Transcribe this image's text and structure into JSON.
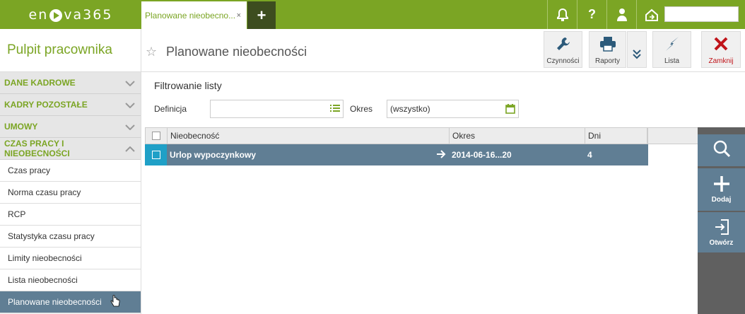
{
  "app": {
    "logo": "enova365"
  },
  "tabs": [
    {
      "label": "Planowane nieobecno...",
      "close": "×"
    }
  ],
  "add_tab_label": "+",
  "top_icons": [
    {
      "name": "bell-icon",
      "glyph": "🔔"
    },
    {
      "name": "help-icon",
      "glyph": "?"
    },
    {
      "name": "user-icon",
      "glyph": "👤"
    },
    {
      "name": "home-icon",
      "glyph": "⌂"
    }
  ],
  "sidebar": {
    "title": "Pulpit pracownika",
    "groups": [
      {
        "label": "DANE KADROWE",
        "chevron": "⌄"
      },
      {
        "label": "KADRY POZOSTAŁE",
        "chevron": "⌄"
      },
      {
        "label": "UMOWY",
        "chevron": "⌄"
      },
      {
        "label": "CZAS PRACY I NIEOBECNOŚCI",
        "chevron": "⌃"
      }
    ],
    "items": [
      {
        "label": "Czas pracy"
      },
      {
        "label": "Norma czasu pracy"
      },
      {
        "label": "RCP"
      },
      {
        "label": "Statystyka czasu pracy"
      },
      {
        "label": "Limity nieobecności"
      },
      {
        "label": "Lista nieobecności"
      },
      {
        "label": "Planowane nieobecności"
      }
    ]
  },
  "header": {
    "title": "Planowane nieobecności",
    "toolbar": {
      "czynnosci": "Czynności",
      "raporty": "Raporty",
      "lista": "Lista",
      "zamknij": "Zamknij"
    }
  },
  "filter": {
    "title": "Filtrowanie listy",
    "definicja_label": "Definicja",
    "definicja_value": "",
    "okres_label": "Okres",
    "okres_value": "(wszystko)"
  },
  "table": {
    "columns": [
      "Nieobecność",
      "Okres",
      "Dni"
    ],
    "rows": [
      {
        "nieobecnosc": "Urlop wypoczynkowy",
        "okres": "2014-06-16...20",
        "dni": "4"
      }
    ]
  },
  "actions": {
    "dodaj": "Dodaj",
    "otworz": "Otwórz"
  },
  "colors": {
    "brand": "#7ba524",
    "selection": "#607e94",
    "close": "#c0141a"
  }
}
